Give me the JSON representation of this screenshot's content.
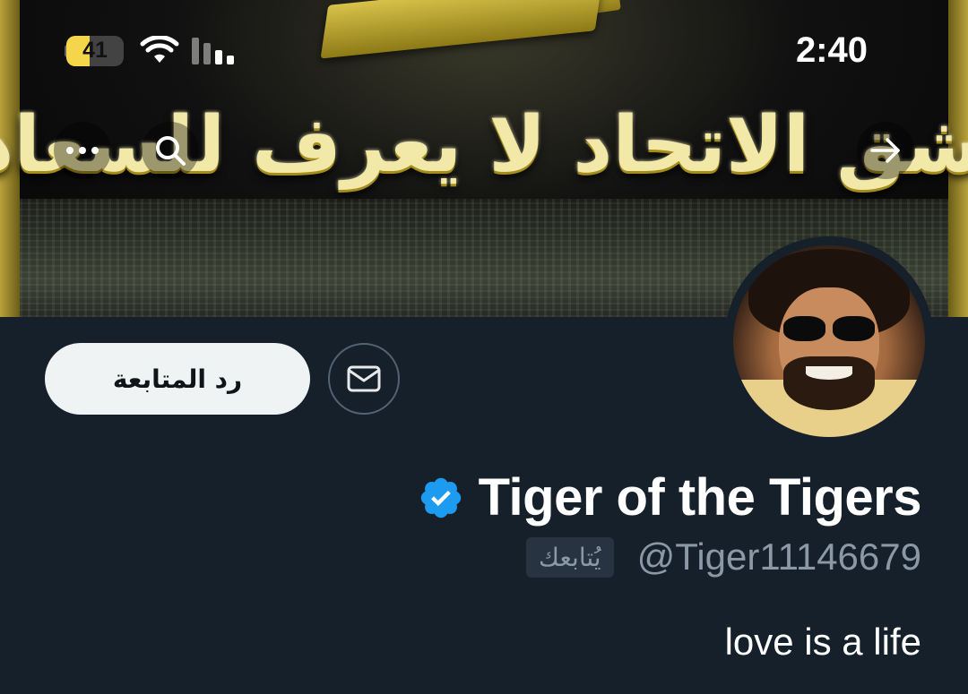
{
  "status_bar": {
    "battery_level": "41",
    "battery_fraction": 0.41,
    "time": "2:40"
  },
  "banner": {
    "slogan": "من لا يعشق الاتحاد لا يعرف للسعادة طريق"
  },
  "icons": {
    "back": "arrow-right-icon",
    "search": "search-icon",
    "more": "more-icon",
    "message": "mail-icon",
    "verified": "verified-badge-icon"
  },
  "colors": {
    "background": "#15202b",
    "verified": "#1d9bf0",
    "battery": "#f5d64a",
    "secondary_text": "#8b98a5"
  },
  "profile": {
    "follow_back_label": "رد المتابعة",
    "display_name": "Tiger of the Tigers",
    "handle": "@Tiger11146679",
    "follows_you_label": "يُتابعك",
    "bio": "love is a life",
    "verified": true
  }
}
